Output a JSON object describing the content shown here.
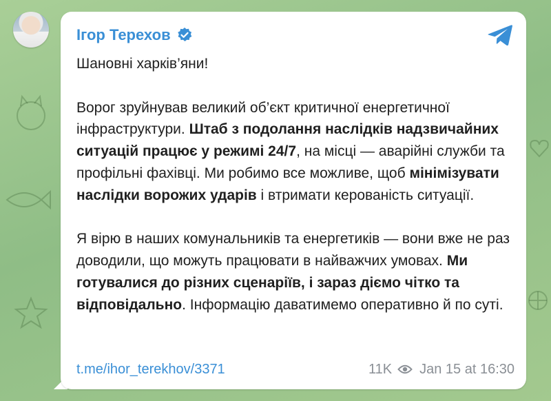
{
  "post": {
    "sender": "Ігор Терехов",
    "greeting": "Шановні харків’яни!",
    "p1": {
      "a": "Ворог зруйнував великий об’єкт критичної енергетичної інфраструктури. ",
      "b": "Штаб з подолання наслідків надзвичайних ситуацій працює у режимі 24/7",
      "c": ", на місці — аварійні служби та профільні фахівці. Ми робимо все можливе, щоб ",
      "d": "мінімізувати наслідки ворожих ударів",
      "e": " і втримати керованість ситуації."
    },
    "p2": {
      "a": "Я вірю в наших комунальників та енергетиків — вони вже не раз доводили, що можуть працювати в найважчих умовах. ",
      "b": "Ми готувалися до різних сценаріїв, і зараз діємо чітко та відповідально",
      "c": ". Інформацію даватимемо оперативно й по суті."
    },
    "link": "t.me/ihor_terekhov/3371",
    "views": "11K",
    "timestamp": "Jan 15 at 16:30"
  },
  "colors": {
    "accent": "#3a8fd6",
    "meta": "#8a8f95",
    "wallpaper": "#9dc58e"
  },
  "icons": {
    "verified": "verified-badge-icon",
    "share": "telegram-share-icon",
    "views": "eye-icon"
  }
}
